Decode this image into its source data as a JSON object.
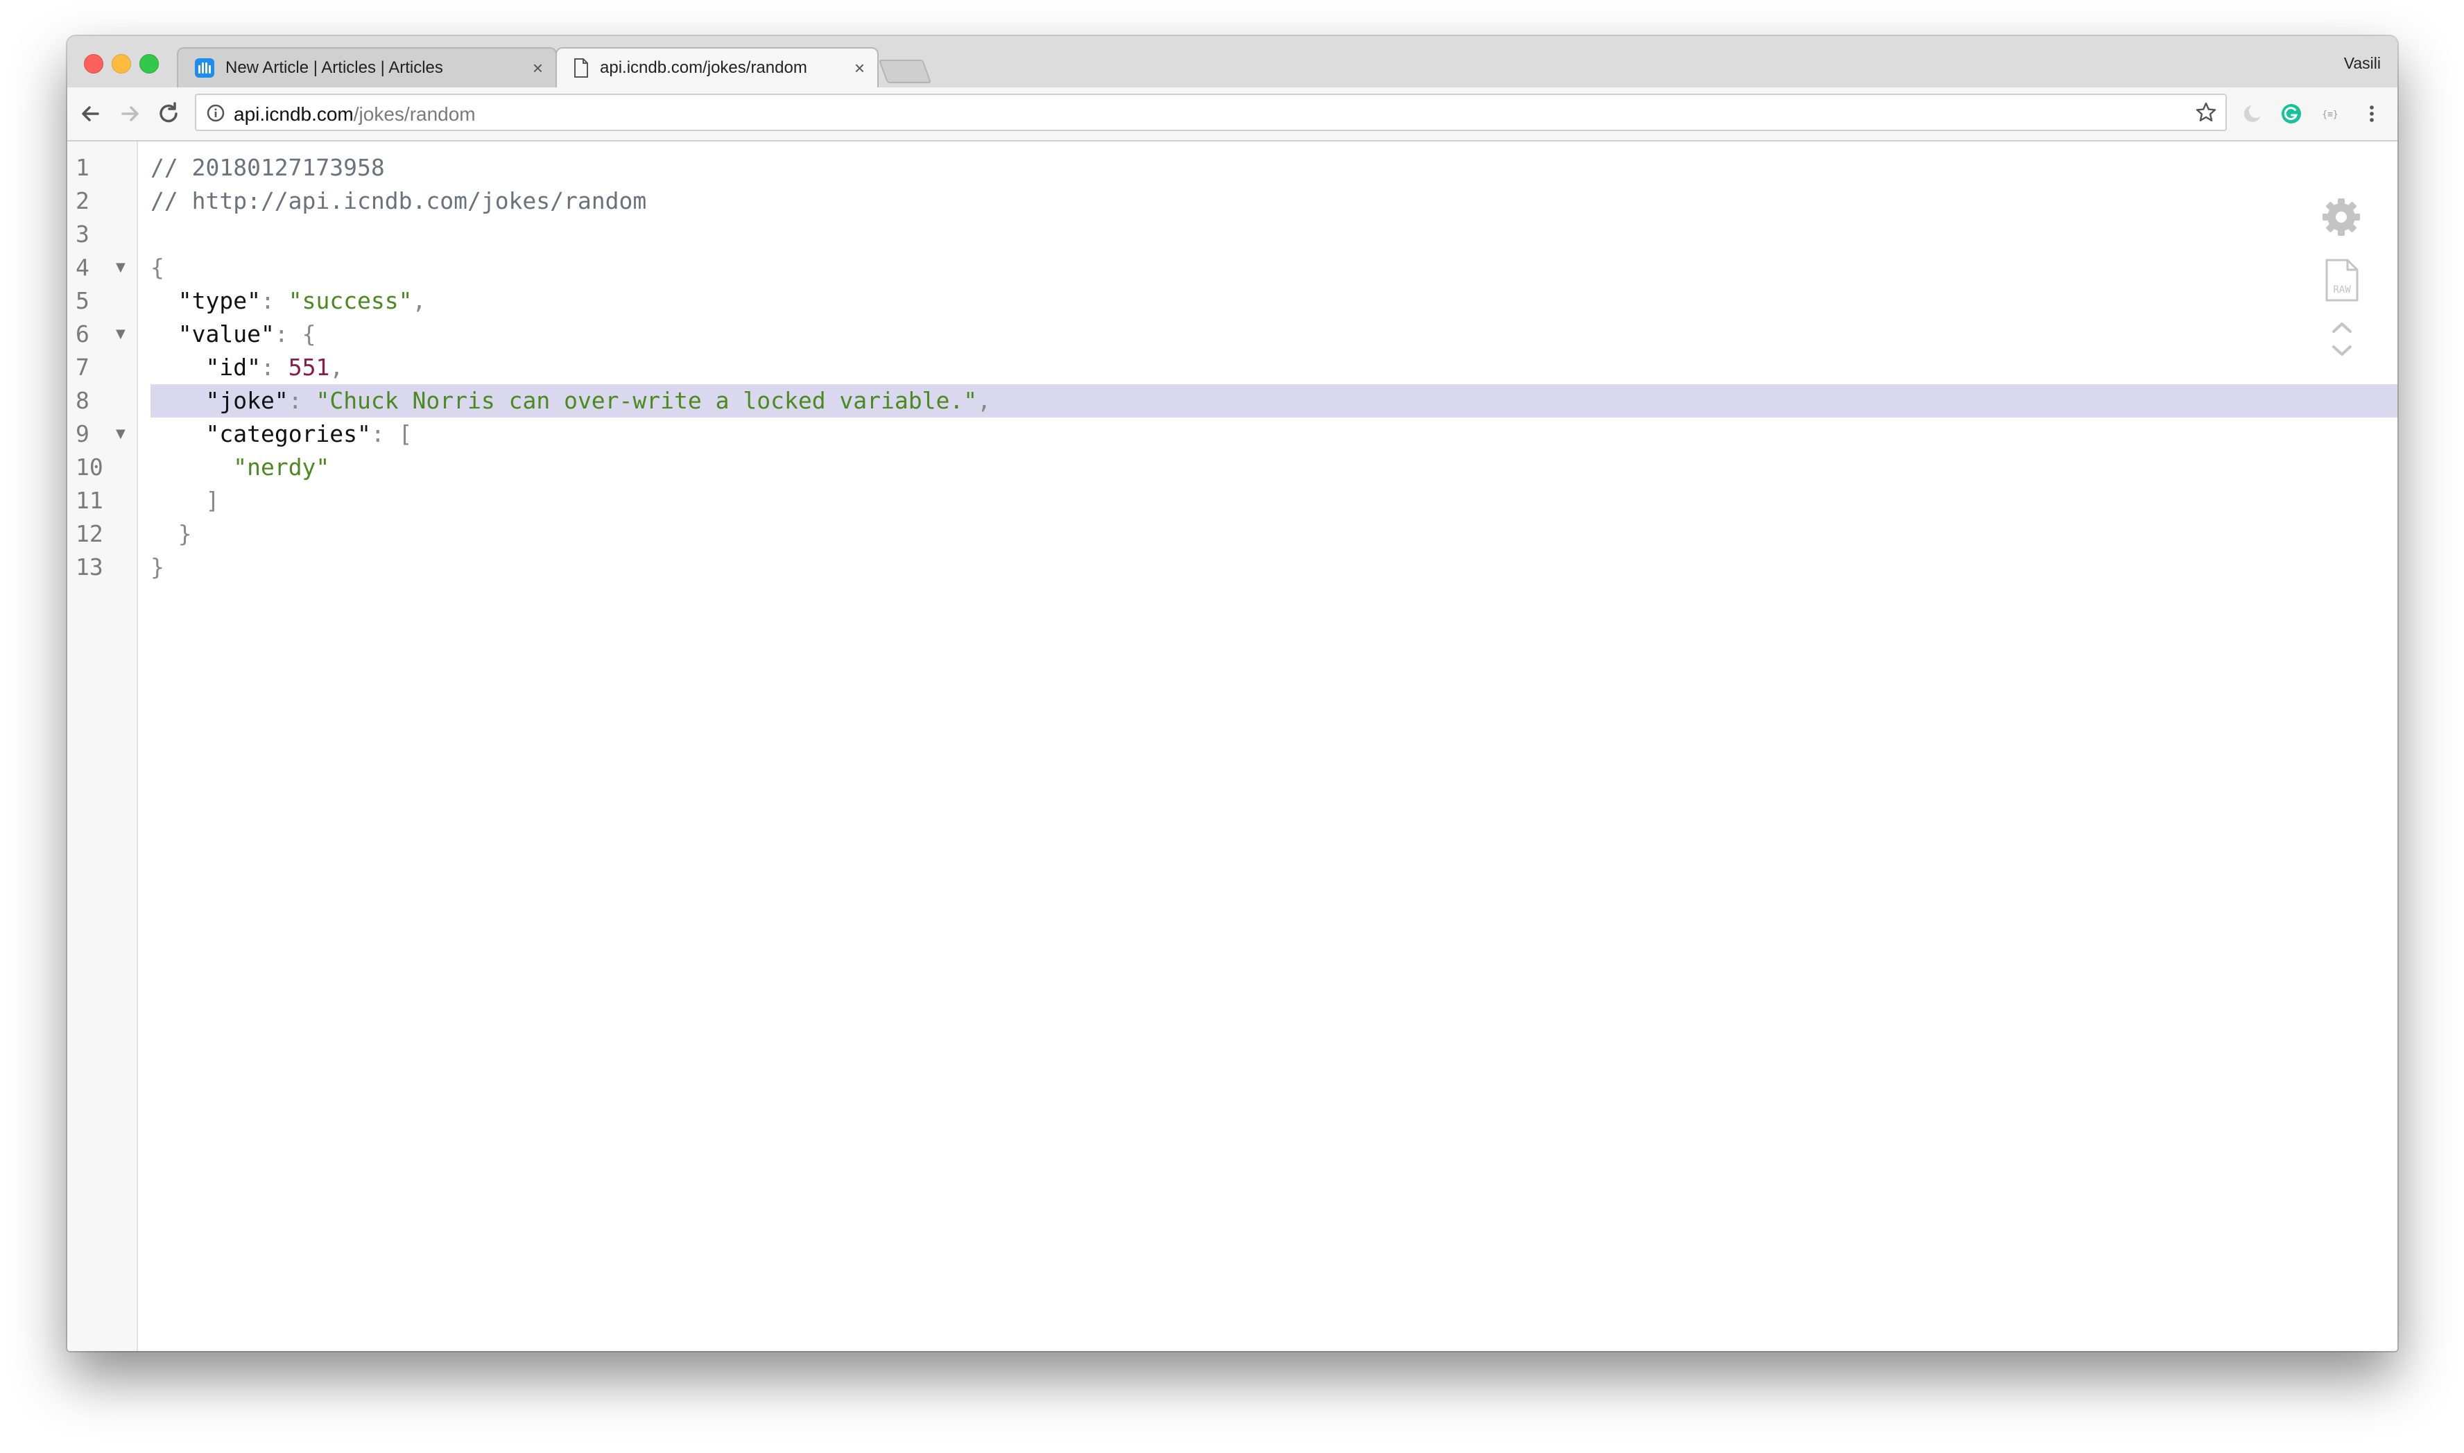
{
  "browser": {
    "tabs": [
      {
        "title": "New Article | Articles | Articles",
        "active": false,
        "favicon": "intercom-icon"
      },
      {
        "title": "api.icndb.com/jokes/random",
        "active": true,
        "favicon": "page-icon"
      }
    ],
    "tab_close_glyph": "×",
    "user": "Vasili",
    "url_host": "api.icndb.com",
    "url_path": "/jokes/random"
  },
  "viewer": {
    "lines": [
      {
        "num": "1",
        "fold": "",
        "tokens": [
          {
            "t": "comment",
            "v": "// 20180127173958"
          }
        ]
      },
      {
        "num": "2",
        "fold": "",
        "tokens": [
          {
            "t": "comment",
            "v": "// http://api.icndb.com/jokes/random"
          }
        ]
      },
      {
        "num": "3",
        "fold": "",
        "tokens": []
      },
      {
        "num": "4",
        "fold": "▼",
        "tokens": [
          {
            "t": "punc",
            "v": "{"
          }
        ]
      },
      {
        "num": "5",
        "fold": "",
        "tokens": [
          {
            "t": "ws",
            "v": "  "
          },
          {
            "t": "key",
            "v": "\"type\""
          },
          {
            "t": "punc",
            "v": ": "
          },
          {
            "t": "str",
            "v": "\"success\""
          },
          {
            "t": "punc",
            "v": ","
          }
        ]
      },
      {
        "num": "6",
        "fold": "▼",
        "tokens": [
          {
            "t": "ws",
            "v": "  "
          },
          {
            "t": "key",
            "v": "\"value\""
          },
          {
            "t": "punc",
            "v": ": {"
          }
        ]
      },
      {
        "num": "7",
        "fold": "",
        "tokens": [
          {
            "t": "ws",
            "v": "    "
          },
          {
            "t": "key",
            "v": "\"id\""
          },
          {
            "t": "punc",
            "v": ": "
          },
          {
            "t": "num",
            "v": "551"
          },
          {
            "t": "punc",
            "v": ","
          }
        ]
      },
      {
        "num": "8",
        "fold": "",
        "highlight": true,
        "tokens": [
          {
            "t": "ws",
            "v": "    "
          },
          {
            "t": "key",
            "v": "\"joke\""
          },
          {
            "t": "punc",
            "v": ": "
          },
          {
            "t": "str",
            "v": "\"Chuck Norris can over-write a locked variable.\""
          },
          {
            "t": "punc",
            "v": ","
          }
        ]
      },
      {
        "num": "9",
        "fold": "▼",
        "tokens": [
          {
            "t": "ws",
            "v": "    "
          },
          {
            "t": "key",
            "v": "\"categories\""
          },
          {
            "t": "punc",
            "v": ": ["
          }
        ]
      },
      {
        "num": "10",
        "fold": "",
        "tokens": [
          {
            "t": "ws",
            "v": "      "
          },
          {
            "t": "str",
            "v": "\"nerdy\""
          }
        ]
      },
      {
        "num": "11",
        "fold": "",
        "tokens": [
          {
            "t": "ws",
            "v": "    "
          },
          {
            "t": "punc",
            "v": "]"
          }
        ]
      },
      {
        "num": "12",
        "fold": "",
        "tokens": [
          {
            "t": "ws",
            "v": "  "
          },
          {
            "t": "punc",
            "v": "}"
          }
        ]
      },
      {
        "num": "13",
        "fold": "",
        "tokens": [
          {
            "t": "punc",
            "v": "}"
          }
        ]
      }
    ],
    "side_tools": [
      "gear-icon",
      "raw-file-icon",
      "chevron-up-icon",
      "chevron-down-icon"
    ],
    "raw_label": "RAW"
  },
  "colors": {
    "highlight": "#d9d8ee",
    "string": "#4a8a1e",
    "number": "#8a1c4a",
    "comment": "#6a737d"
  }
}
